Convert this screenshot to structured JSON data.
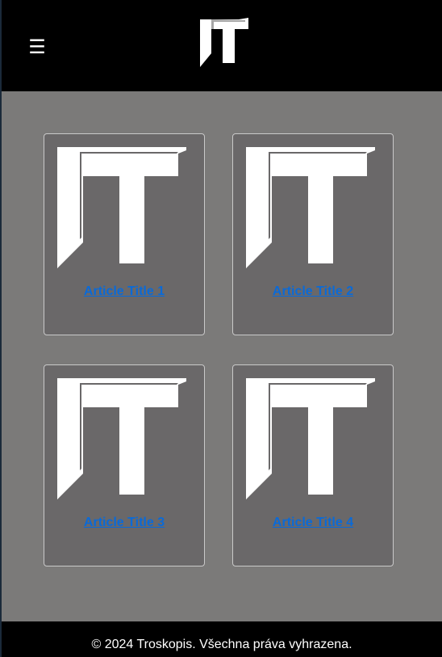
{
  "header": {
    "menu_icon": "hamburger-icon",
    "menu_glyph": "☰",
    "logo_icon": "troskopis-logo"
  },
  "articles": [
    {
      "title": "Article Title 1",
      "image_icon": "troskopis-logo"
    },
    {
      "title": "Article Title 2",
      "image_icon": "troskopis-logo"
    },
    {
      "title": "Article Title 3",
      "image_icon": "troskopis-logo"
    },
    {
      "title": "Article Title 4",
      "image_icon": "troskopis-logo"
    }
  ],
  "footer": {
    "copyright": "© 2024 Troskopis. Všechna práva vyhrazena."
  },
  "colors": {
    "header_bg": "#000000",
    "page_bg": "#7b7a79",
    "card_bg": "#6a6869",
    "card_border": "#c9c9c9",
    "link": "#0a6ad8",
    "footer_text": "#ffffff"
  }
}
